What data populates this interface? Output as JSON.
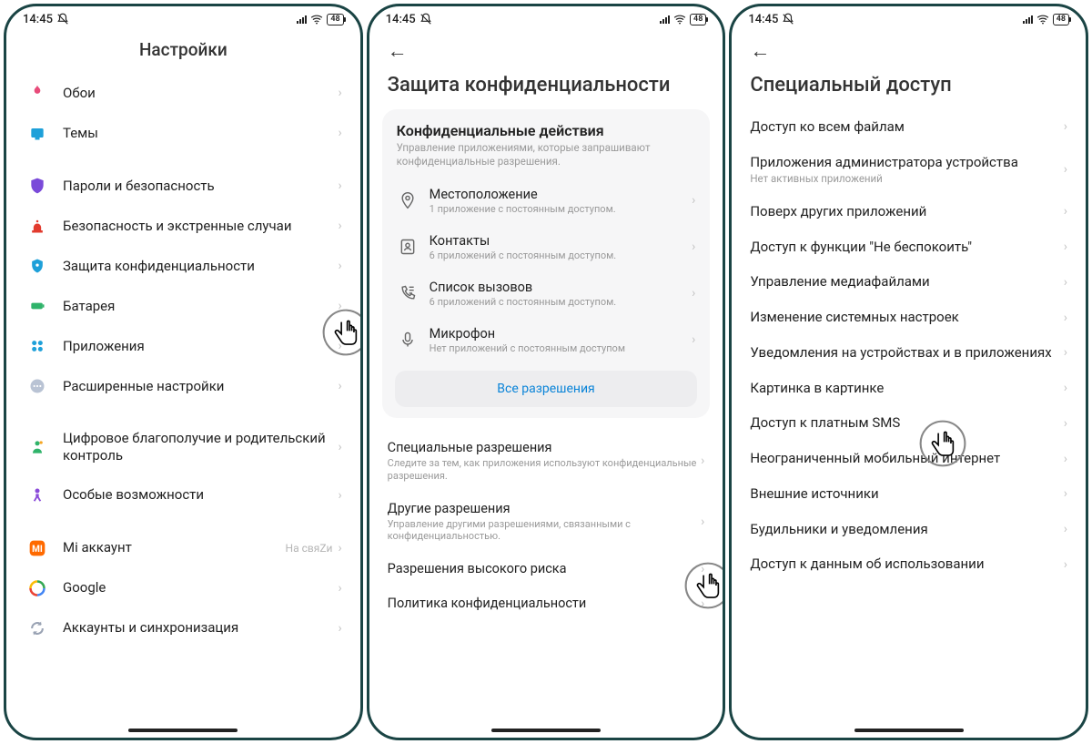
{
  "status": {
    "time": "14:45",
    "battery": "48"
  },
  "phone1": {
    "title": "Настройки",
    "groups": [
      [
        {
          "icon": "wallpaper",
          "color": "#e84b7a",
          "label": "Обои"
        },
        {
          "icon": "themes",
          "color": "#1ea0d9",
          "label": "Темы"
        }
      ],
      [
        {
          "icon": "shield",
          "color": "#7a4ad9",
          "label": "Пароли и безопасность"
        },
        {
          "icon": "siren",
          "color": "#e23b2e",
          "label": "Безопасность и экстренные случаи"
        },
        {
          "icon": "privacy",
          "color": "#1ea0d9",
          "label": "Защита конфиденциальности"
        },
        {
          "icon": "battery",
          "color": "#2fb36a",
          "label": "Батарея"
        },
        {
          "icon": "apps",
          "color": "#1ea0d9",
          "label": "Приложения"
        },
        {
          "icon": "dots",
          "color": "#b9c3d4",
          "label": "Расширенные настройки"
        }
      ],
      [
        {
          "icon": "wellbeing",
          "color": "#2fb36a",
          "label": "Цифровое благополучие и родительский контроль"
        },
        {
          "icon": "access",
          "color": "#8a4ad9",
          "label": "Особые возможности"
        }
      ],
      [
        {
          "icon": "mi",
          "color": "#ff6a00",
          "label": "Mi аккаунт",
          "status": "На свяZи"
        },
        {
          "icon": "google",
          "color": "",
          "label": "Google"
        },
        {
          "icon": "sync",
          "color": "#9aa3b4",
          "label": "Аккаунты и синхронизация"
        }
      ]
    ]
  },
  "phone2": {
    "title": "Защита конфиденциальности",
    "card": {
      "title": "Конфиденциальные действия",
      "desc": "Управление приложениями, которые запрашивают конфиденциальные разрешения.",
      "items": [
        {
          "icon": "location",
          "label": "Местоположение",
          "sub": "1 приложение с постоянным доступом."
        },
        {
          "icon": "contacts",
          "label": "Контакты",
          "sub": "6 приложений с постоянным доступом."
        },
        {
          "icon": "calllog",
          "label": "Список вызовов",
          "sub": "6 приложений с постоянным доступом."
        },
        {
          "icon": "mic",
          "label": "Микрофон",
          "sub": "Нет приложений с постоянным доступом"
        }
      ],
      "allBtn": "Все разрешения"
    },
    "sections": [
      {
        "label": "Специальные разрешения",
        "sub": "Следите за тем, как приложения используют конфиденциальные разрешения."
      },
      {
        "label": "Другие разрешения",
        "sub": "Управление другими разрешениями, связанными с конфиденциальностью."
      },
      {
        "label": "Разрешения высокого риска",
        "sub": ""
      },
      {
        "label": "Политика конфиденциальности",
        "sub": ""
      }
    ]
  },
  "phone3": {
    "title": "Специальный доступ",
    "items": [
      {
        "label": "Доступ ко всем файлам",
        "sub": ""
      },
      {
        "label": "Приложения администратора устройства",
        "sub": "Нет активных приложений"
      },
      {
        "label": "Поверх других приложений",
        "sub": ""
      },
      {
        "label": "Доступ к функции \"Не беспокоить\"",
        "sub": ""
      },
      {
        "label": "Управление медиафайлами",
        "sub": ""
      },
      {
        "label": "Изменение системных настроек",
        "sub": ""
      },
      {
        "label": "Уведомления на устройствах и в приложениях",
        "sub": ""
      },
      {
        "label": "Картинка в картинке",
        "sub": ""
      },
      {
        "label": "Доступ к платным SMS",
        "sub": ""
      },
      {
        "label": "Неограниченный мобильный интернет",
        "sub": ""
      },
      {
        "label": "Внешние источники",
        "sub": ""
      },
      {
        "label": "Будильники и уведомления",
        "sub": ""
      },
      {
        "label": "Доступ к данным об использовании",
        "sub": ""
      }
    ]
  }
}
